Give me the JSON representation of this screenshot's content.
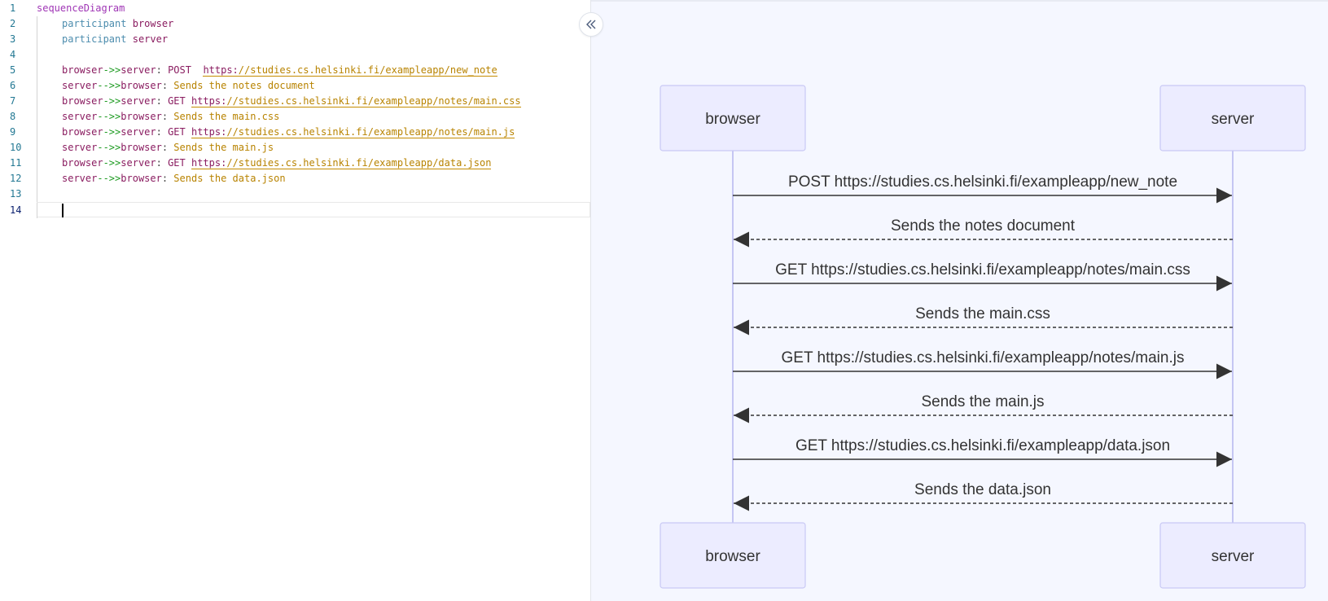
{
  "editor": {
    "lines": [
      {
        "n": "1",
        "kind": "header",
        "keyword": "sequenceDiagram"
      },
      {
        "n": "2",
        "kind": "participant",
        "keyword": "participant",
        "name": "browser"
      },
      {
        "n": "3",
        "kind": "participant",
        "keyword": "participant",
        "name": "server"
      },
      {
        "n": "4",
        "kind": "blank"
      },
      {
        "n": "5",
        "kind": "msg",
        "from": "browser",
        "arrow": "->>",
        "to": "server",
        "verb": "POST  ",
        "url_scheme": "https:",
        "url_rest": "//studies.cs.helsinki.fi/exampleapp/new_note"
      },
      {
        "n": "6",
        "kind": "reply",
        "from": "server",
        "arrow": "-->>",
        "to": "browser",
        "text": "Sends the notes document"
      },
      {
        "n": "7",
        "kind": "msg",
        "from": "browser",
        "arrow": "->>",
        "to": "server",
        "verb": "GET ",
        "url_scheme": "https:",
        "url_rest": "//studies.cs.helsinki.fi/exampleapp/notes/main.css"
      },
      {
        "n": "8",
        "kind": "reply",
        "from": "server",
        "arrow": "-->>",
        "to": "browser",
        "text": "Sends the main.css"
      },
      {
        "n": "9",
        "kind": "msg",
        "from": "browser",
        "arrow": "->>",
        "to": "server",
        "verb": "GET ",
        "url_scheme": "https:",
        "url_rest": "//studies.cs.helsinki.fi/exampleapp/notes/main.js"
      },
      {
        "n": "10",
        "kind": "reply",
        "from": "server",
        "arrow": "-->>",
        "to": "browser",
        "text": "Sends the main.js"
      },
      {
        "n": "11",
        "kind": "msg",
        "from": "browser",
        "arrow": "->>",
        "to": "server",
        "verb": "GET ",
        "url_scheme": "https:",
        "url_rest": "//studies.cs.helsinki.fi/exampleapp/data.json"
      },
      {
        "n": "12",
        "kind": "reply",
        "from": "server",
        "arrow": "-->>",
        "to": "browser",
        "text": "Sends the data.json"
      },
      {
        "n": "13",
        "kind": "blank"
      },
      {
        "n": "14",
        "kind": "current"
      }
    ],
    "colon": ": "
  },
  "collapse_button": {
    "icon": "double-chevron-left-icon",
    "glyph": "«"
  },
  "diagram": {
    "participants": [
      "browser",
      "server"
    ],
    "messages": [
      {
        "from": 0,
        "to": 1,
        "label": "POST https://studies.cs.helsinki.fi/exampleapp/new_note",
        "style": "solid"
      },
      {
        "from": 1,
        "to": 0,
        "label": "Sends the notes document",
        "style": "dashed"
      },
      {
        "from": 0,
        "to": 1,
        "label": "GET https://studies.cs.helsinki.fi/exampleapp/notes/main.css",
        "style": "solid"
      },
      {
        "from": 1,
        "to": 0,
        "label": "Sends the main.css",
        "style": "dashed"
      },
      {
        "from": 0,
        "to": 1,
        "label": "GET https://studies.cs.helsinki.fi/exampleapp/notes/main.js",
        "style": "solid"
      },
      {
        "from": 1,
        "to": 0,
        "label": "Sends the main.js",
        "style": "dashed"
      },
      {
        "from": 0,
        "to": 1,
        "label": "GET https://studies.cs.helsinki.fi/exampleapp/data.json",
        "style": "solid"
      },
      {
        "from": 1,
        "to": 0,
        "label": "Sends the data.json",
        "style": "dashed"
      }
    ],
    "colors": {
      "actor_fill": "#ececff",
      "actor_stroke": "#c9c9f5",
      "lifeline": "#b9b9f0",
      "message": "#333333"
    }
  }
}
